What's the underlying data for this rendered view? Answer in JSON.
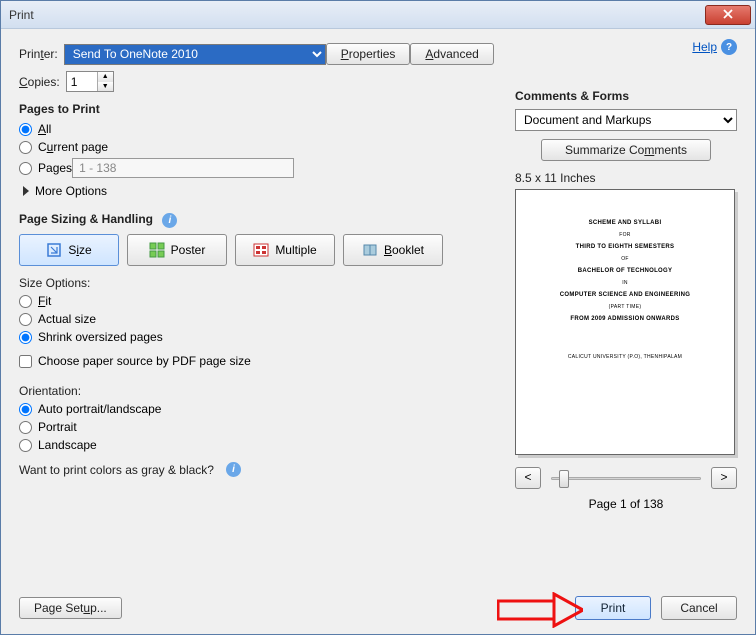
{
  "window": {
    "title": "Print"
  },
  "header": {
    "help": "Help"
  },
  "printer": {
    "label_pre": "Prin",
    "label_u": "t",
    "label_post": "er:",
    "value": "Send To OneNote 2010",
    "properties_u": "P",
    "properties_post": "roperties",
    "advanced_u": "A",
    "advanced_post": "dvanced"
  },
  "copies": {
    "label_u": "C",
    "label_post": "opies:",
    "value": "1"
  },
  "pages": {
    "title": "Pages to Print",
    "all_u": "A",
    "all_post": "ll",
    "current_pre": "C",
    "current_u": "u",
    "current_post": "rrent page",
    "range_pre": "Pa",
    "range_u": "g",
    "range_post": "es",
    "range_value": "1 - 138",
    "more": "More Options"
  },
  "sizing": {
    "title": "Page Sizing & Handling",
    "tabs": [
      {
        "pre": "S",
        "u": "i",
        "post": "ze"
      },
      {
        "label": "Poster"
      },
      {
        "label": "Multiple"
      },
      {
        "u": "B",
        "post": "ooklet"
      }
    ],
    "size_options": "Size Options:",
    "fit_u": "F",
    "fit_post": "it",
    "actual": "Actual size",
    "shrink": "Shrink oversized pages",
    "paper_source": "Choose paper source by PDF page size"
  },
  "orientation": {
    "title": "Orientation:",
    "auto": "Auto portrait/landscape",
    "portrait": "Portrait",
    "landscape": "Landscape"
  },
  "gray": {
    "text": "Want to print colors as gray & black?"
  },
  "comments": {
    "title": "Comments & Forms",
    "value": "Document and Markups",
    "summarize_pre": "Summarize Co",
    "summarize_u": "m",
    "summarize_post": "ments"
  },
  "preview": {
    "size": "8.5 x 11 Inches",
    "lines": [
      "SCHEME AND SYLLABI",
      "FOR",
      "THIRD TO EIGHTH SEMESTERS",
      "OF",
      "BACHELOR OF TECHNOLOGY",
      "IN",
      "COMPUTER SCIENCE AND ENGINEERING",
      "(PART TIME)",
      "FROM 2009 ADMISSION ONWARDS",
      "CALICUT UNIVERSITY (P.O), THENHIPALAM"
    ],
    "page_of": "Page 1 of 138"
  },
  "footer": {
    "page_setup_pre": "Page Set",
    "page_setup_u": "u",
    "page_setup_post": "p...",
    "print": "Print",
    "cancel": "Cancel"
  }
}
